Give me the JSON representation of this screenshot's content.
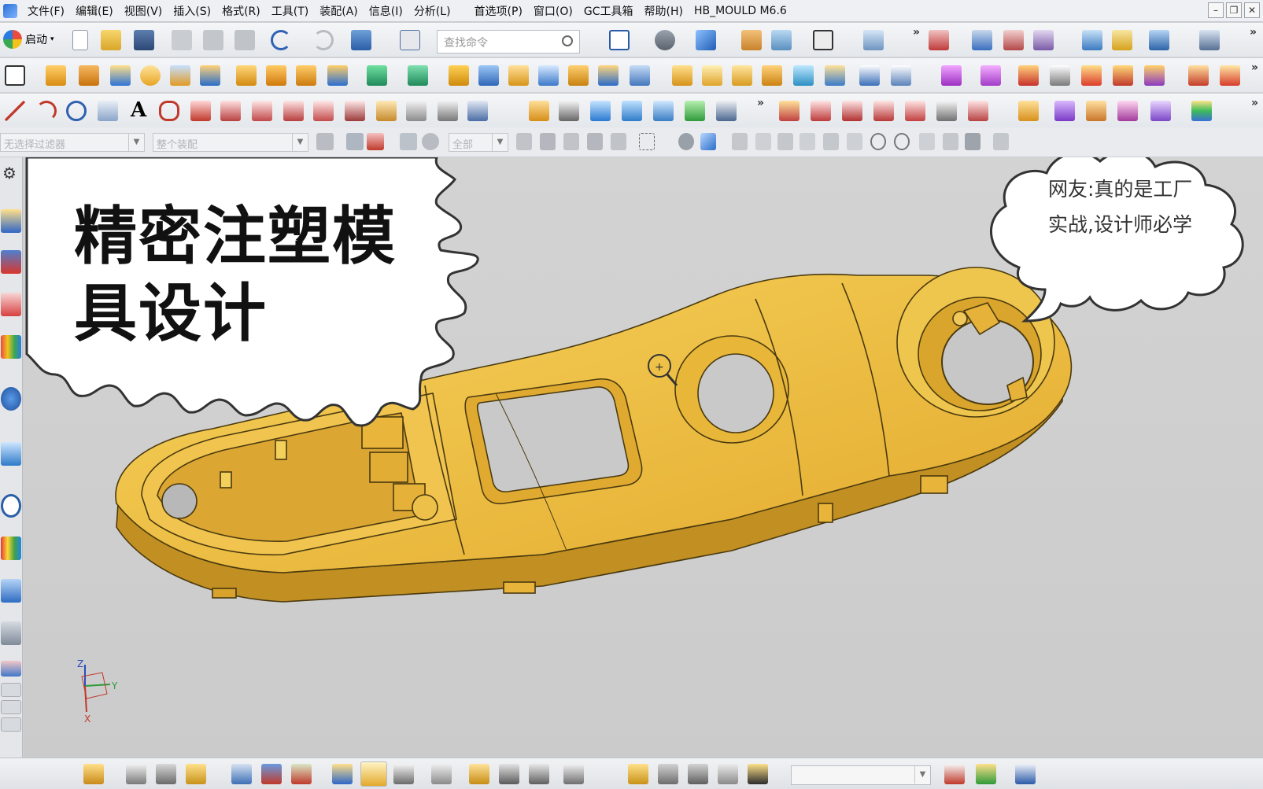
{
  "menu": {
    "items": [
      "文件(F)",
      "编辑(E)",
      "视图(V)",
      "插入(S)",
      "格式(R)",
      "工具(T)",
      "装配(A)",
      "信息(I)",
      "分析(L)",
      "首选项(P)",
      "窗口(O)",
      "GC工具箱",
      "帮助(H)",
      "HB_MOULD M6.6"
    ]
  },
  "window_controls": [
    "–",
    "❐",
    "✕"
  ],
  "toolbar": {
    "start_label": "启动",
    "search_placeholder": "查找命令",
    "overflow": "»"
  },
  "selection_bar": {
    "filter_value": "无选择过滤器",
    "scope_value": "整个装配",
    "layer_value": "全部"
  },
  "viewport": {
    "title_line1": "精密注塑模",
    "title_line2": "具设计",
    "comment_line1": "网友:真的是工厂",
    "comment_line2": "实战,设计师必学",
    "axis_z": "Z",
    "axis_y": "Y",
    "axis_x": "X"
  },
  "colors": {
    "part": "#e8b63a",
    "part_highlight": "#f6d461",
    "part_shadow": "#b5861c",
    "viewport_bg": "#cfcfcf"
  }
}
